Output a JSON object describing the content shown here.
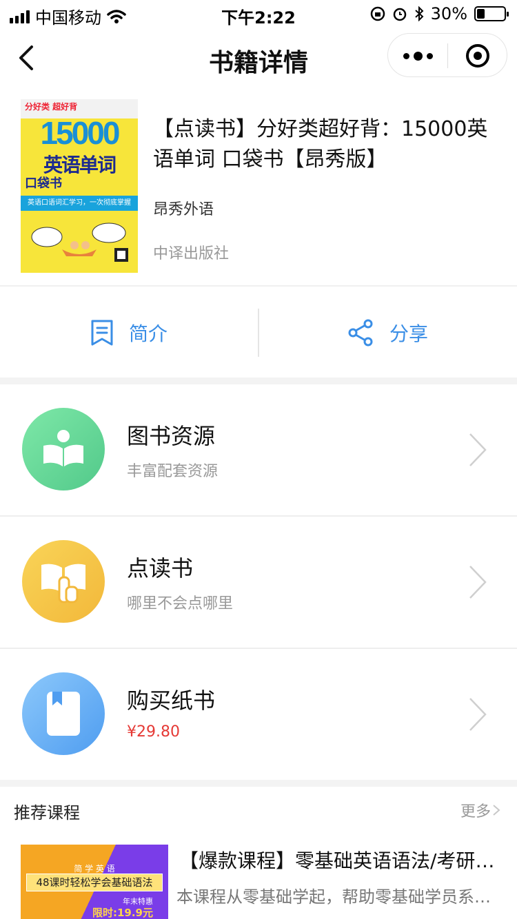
{
  "status_bar": {
    "carrier": "中国移动",
    "time": "下午2:22",
    "battery_text": "30%",
    "battery_level": 0.3
  },
  "nav": {
    "title": "书籍详情"
  },
  "book": {
    "title": "【点读书】分好类超好背：15000英语单词 口袋书【昂秀版】",
    "author": "昂秀外语",
    "publisher": "中译出版社",
    "cover": {
      "headline": "分好类 超好背",
      "number": "15000",
      "title_line1": "英语单词",
      "title_line2": "口袋书",
      "band_text": "英语口语词汇学习，一次彻底掌握"
    }
  },
  "actions": {
    "intro_label": "简介",
    "share_label": "分享"
  },
  "features": [
    {
      "name": "图书资源",
      "desc": "丰富配套资源",
      "color": "#6fd99b"
    },
    {
      "name": "点读书",
      "desc": "哪里不会点哪里",
      "color": "#f6c543"
    },
    {
      "name": "购买纸书",
      "desc": "¥29.80",
      "color": "#5aa9f2"
    }
  ],
  "recommended": {
    "label": "推荐课程",
    "more_label": "更多",
    "course": {
      "title": "【爆款课程】零基础英语语法/考研/考公/考四六级/中高考",
      "desc": "本课程从零基础学起，帮助零基础学员系统掌握英语语法",
      "thumb_line1": "简 学 英 语",
      "thumb_line2": "48课时轻松学会基础语法",
      "thumb_line3": "年末特惠",
      "thumb_line4": "限时:19.9元"
    }
  },
  "colors": {
    "accent": "#3a8ee6",
    "price": "#e53935"
  }
}
